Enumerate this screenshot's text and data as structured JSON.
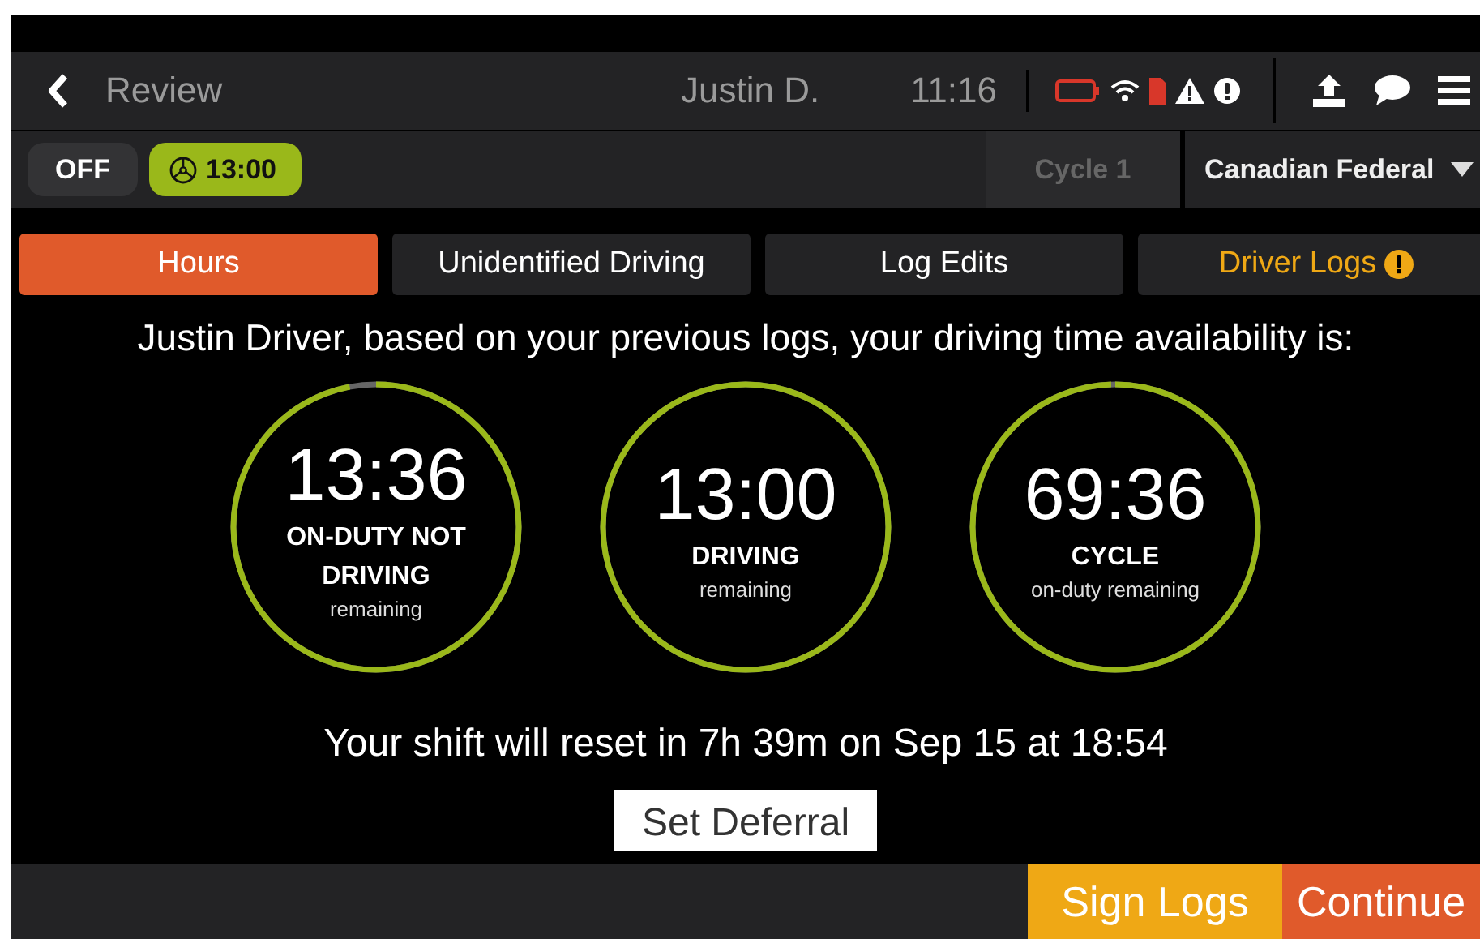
{
  "header": {
    "back_label": "Review",
    "driver": "Justin D.",
    "time": "11:16"
  },
  "duty_bar": {
    "statuses": [
      {
        "label": "OFF",
        "selected": false,
        "kind": "off"
      },
      {
        "label": "13:00",
        "selected": true,
        "kind": "driving"
      }
    ],
    "cycle": "Cycle 1",
    "ruleset": "Canadian Federal"
  },
  "tabs": [
    {
      "label": "Hours",
      "selected": true,
      "alert": false
    },
    {
      "label": "Unidentified Driving",
      "selected": false,
      "alert": false
    },
    {
      "label": "Log Edits",
      "selected": false,
      "alert": false
    },
    {
      "label": "Driver Logs",
      "selected": false,
      "alert": true
    }
  ],
  "message": "Justin Driver, based on your previous logs, your driving time availability is:",
  "clocks": [
    {
      "value": "13:36",
      "label": "ON-DUTY NOT DRIVING",
      "sublabel": "remaining"
    },
    {
      "value": "13:00",
      "label": "DRIVING",
      "sublabel": "remaining"
    },
    {
      "value": "69:36",
      "label": "CYCLE",
      "sublabel": "on-duty remaining"
    }
  ],
  "reset_text": "Your shift will reset in 7h 39m on Sep 15 at 18:54",
  "deferral_button": "Set Deferral",
  "footer_buttons": [
    {
      "label": "Sign Logs",
      "kind": "sign"
    },
    {
      "label": "Continue",
      "kind": "continue"
    }
  ]
}
